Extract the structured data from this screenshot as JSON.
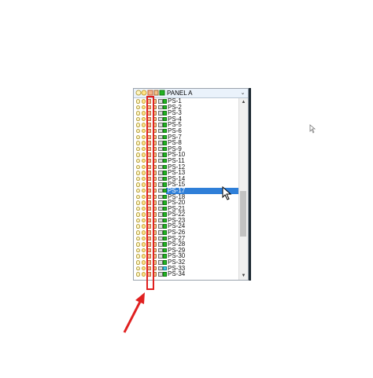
{
  "panel": {
    "title": "PANEL A",
    "dropdown_icon": "chevron-down-icon"
  },
  "layers": [
    {
      "name": "PS-1"
    },
    {
      "name": "PS-2"
    },
    {
      "name": "PS-3"
    },
    {
      "name": "PS-4"
    },
    {
      "name": "PS-5"
    },
    {
      "name": "PS-6"
    },
    {
      "name": "PS-7"
    },
    {
      "name": "PS-8"
    },
    {
      "name": "PS-9"
    },
    {
      "name": "PS-10"
    },
    {
      "name": "PS-11"
    },
    {
      "name": "PS-12"
    },
    {
      "name": "PS-13"
    },
    {
      "name": "PS-14"
    },
    {
      "name": "PS-15"
    },
    {
      "name": "PS-17",
      "selected": true
    },
    {
      "name": "PS-18"
    },
    {
      "name": "PS-20"
    },
    {
      "name": "PS-21"
    },
    {
      "name": "PS-22"
    },
    {
      "name": "PS-23"
    },
    {
      "name": "PS-24"
    },
    {
      "name": "PS-26"
    },
    {
      "name": "PS-27"
    },
    {
      "name": "PS-28"
    },
    {
      "name": "PS-29"
    },
    {
      "name": "PS-30"
    },
    {
      "name": "PS-32"
    },
    {
      "name": "PS-33",
      "color": "cyan"
    },
    {
      "name": "PS-34"
    }
  ],
  "colors": {
    "selection": "#2f7fd8",
    "highlight_box": "#e02020",
    "layer_green": "#22b322",
    "layer_cyan": "#3fc9e4"
  }
}
